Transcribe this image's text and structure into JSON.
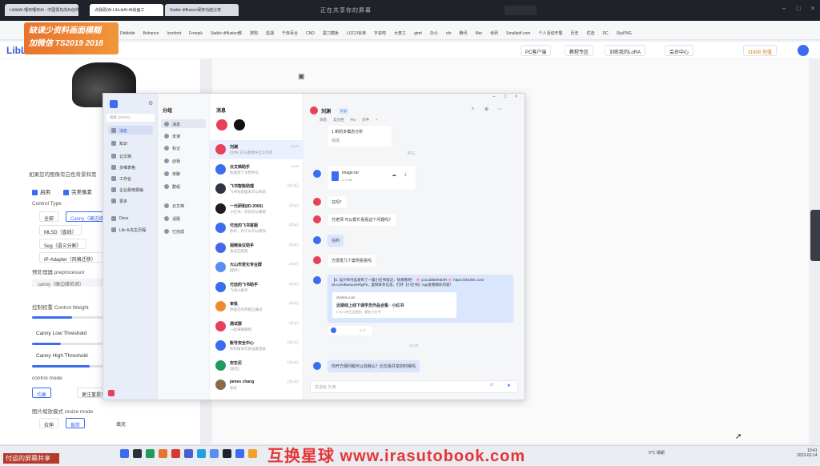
{
  "browser": {
    "tabs": [
      {
        "label": "LiblibAI-哩布哩布AI - 中国领先的AI创作平台"
      },
      {
        "label": "点我即(AI-LibLibAI-AI绘画工"
      },
      {
        "label": "Stable diffusion保存功能分享"
      }
    ],
    "share_title": "正在共享你的屏幕",
    "bookmarks": [
      "Dribbble",
      "Behance",
      "Iconfont",
      "Freepik",
      "Stable diffusion教",
      "搜狗",
      "蓝湖",
      "千库百合",
      "CND",
      "墨刀模板",
      "LOCO标准",
      "字说吧",
      "大麦工",
      "gtmt",
      "办公",
      "cfe",
      "腾讯",
      "Mar",
      "考研",
      "Smallpdf.com",
      "个人活动开展",
      "历史",
      "优选",
      "DC",
      "SkyPNG"
    ]
  },
  "watermark": {
    "line1": "缺课少资料画面模糊",
    "line2": "加微信 TS2019 2018"
  },
  "liblib": {
    "logo": "LibLib",
    "header_buttons": [
      "PC客户端",
      "教程专区",
      "训练我的LoRA",
      "会员中心",
      "11608 充值"
    ]
  },
  "left_panel": {
    "hint": "如果您的图像有白色背景和黑",
    "enable_label": "启用",
    "perfect_pixel_label": "完美像素",
    "control_type_label": "Control Type",
    "control_types": [
      "全部",
      "Canny（硬边缘）",
      "MLSD（直线）",
      "Seg（语义分割）",
      "IP-Adapter（风格迁移）"
    ],
    "preprocessor_label": "预处理器 preprocessor",
    "preprocessor_value": "canny（硬边缘检测）",
    "control_weight_label": "控制权重 Control Weight",
    "control_weight_fill": 0.55,
    "canny_low_label": "Canny Low Threshold",
    "canny_high_label": "Canny High Threshold",
    "control_mode_label": "control mode",
    "control_modes": [
      "均衡",
      "更注重提示词"
    ],
    "resize_mode_label": "图片缩放模式 resize mode",
    "resize_modes": [
      "拉伸",
      "裁剪",
      "填充"
    ]
  },
  "feishu": {
    "search_placeholder": "搜索 (Ctrl+K)",
    "nav": [
      "消息",
      "知识",
      "云文档",
      "多维表格",
      "工作台",
      "企业费用报销",
      "更多",
      "Docs",
      "Lib-大先生历程"
    ],
    "sub_header": "分组",
    "sub_items": [
      "消息",
      "未读",
      "标记",
      "@我",
      "单聊",
      "群组",
      "云文档",
      "话题",
      "已完成"
    ],
    "list_header": "消息",
    "conversations": [
      {
        "name": "刘渊",
        "tag": "外部",
        "preview": "[文件] 在与图像导出工作项",
        "time": "10:20",
        "color": "#e8405a"
      },
      {
        "name": "云文档助手",
        "tag": "机器人",
        "preview": "你收到了文档评论",
        "time": "10:09",
        "color": "#3c6cf0"
      },
      {
        "name": "飞书智能助理",
        "tag": "机器人",
        "preview": "飞书有新版本可以体验",
        "time": "2月13日",
        "color": "#2f3640"
      },
      {
        "name": "一元研和(ID:2069)",
        "tag": "外部",
        "preview": "小红书：你也可以看看",
        "time": "2月9日",
        "color": "#1d1d1f"
      },
      {
        "name": "付远的飞书客服",
        "tag": "官方",
        "preview": "你好，有什么可以帮你",
        "time": "2月8日",
        "color": "#3c6cf0"
      },
      {
        "name": "视频会议助手",
        "tag": "机器人",
        "preview": "会议已结束",
        "time": "2月8日",
        "color": "#4768e8"
      },
      {
        "name": "大山市变化专业群",
        "tag": "外部",
        "preview": "[图片]",
        "time": "2月6日",
        "color": "#5b8ef0"
      },
      {
        "name": "付远的飞书助手",
        "tag": "官方",
        "preview": "飞书小助手",
        "time": "2月5日",
        "color": "#3c6cf0"
      },
      {
        "name": "审批",
        "tag": "机器人",
        "preview": "你提交的审批已通过",
        "time": "2月4日",
        "color": "#f0882e"
      },
      {
        "name": "测试群",
        "tag": "外部",
        "preview": "一起来聊聊吧",
        "time": "2月3日",
        "color": "#e8405a"
      },
      {
        "name": "账号安全中心",
        "tag": "机器人",
        "preview": "你的账号在新设备登录",
        "time": "1月21日",
        "color": "#3c6cf0"
      },
      {
        "name": "安东尼",
        "tag": "外部",
        "preview": "[语音]",
        "time": "1月20日",
        "color": "#1f9c5a"
      },
      {
        "name": "james chang",
        "tag": "外部",
        "preview": "你好",
        "time": "1月19日",
        "color": "#8a6a4a"
      }
    ],
    "chat": {
      "title": "刘渊",
      "title_tag": "外部",
      "tabs": [
        "消息",
        "云文档",
        "Pin",
        "文件"
      ],
      "first_bubble": "1 新的多模态分析",
      "first_bubble_sub": "完成",
      "time_divider_1": "昨天",
      "file_name": "image.rar",
      "file_size": "4.4 MB",
      "m1": "在吗？",
      "m2": "付老师 可以帮忙看看这个问题吗？",
      "m3": "在的",
      "m4": "方便发几个案例看看吗",
      "m5_line1": "【5. 设计师付远发布了一篇小红书笔记，快来看吧！ 🌸 yx1odd59KM3R 🌸 https://xhslink.com/",
      "m5_line2": "nk.com/Bueuo/eR/gP5，复制本条信息，打开【小红书】App查看精彩内容！",
      "card_domain": "xhslink.com",
      "card_title": "近期线上线下课学员作品合集 · 小红书",
      "card_sub": "3 亿人的生活经验，都在小红书",
      "voice_time": "0:17",
      "time_divider_2": "14:20",
      "m6": "你开方便问题可以找我么？比交易共享的时候吗",
      "input_placeholder": "发送给 刘渊"
    }
  },
  "taskbar": {
    "share_label": "付运的屏幕共享",
    "brand_banner": "互换星球 www.irasutobook.com",
    "weather": "9°C 晴朗",
    "time": "10:41",
    "date": "2023-02-14"
  }
}
